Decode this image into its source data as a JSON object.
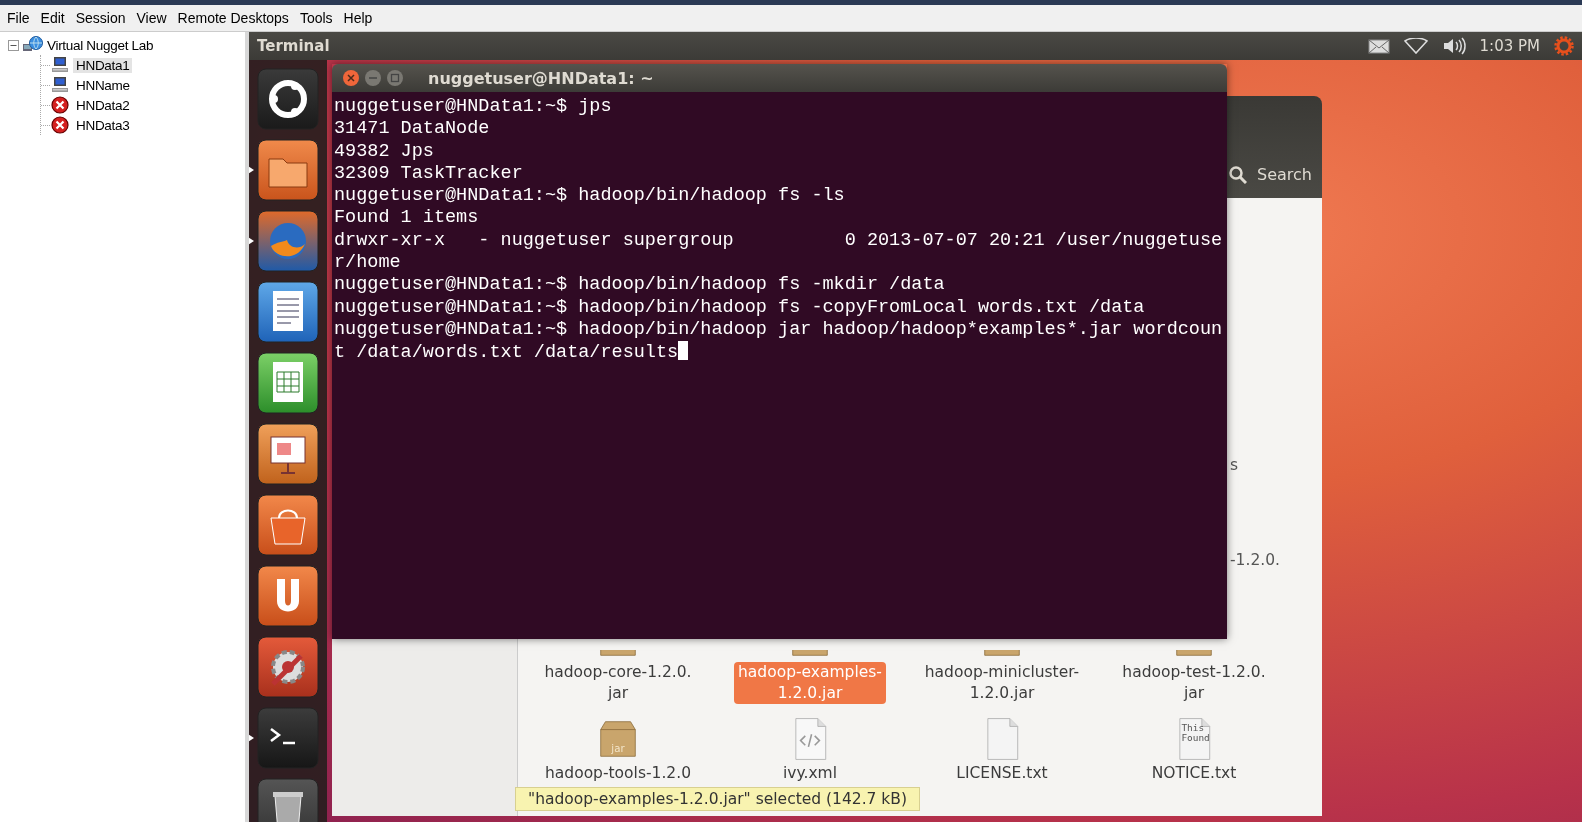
{
  "menu": [
    "File",
    "Edit",
    "Session",
    "View",
    "Remote Desktops",
    "Tools",
    "Help"
  ],
  "tree": {
    "label": "Virtual Nugget Lab",
    "expanded": true,
    "children": [
      {
        "label": "HNData1",
        "kind": "online",
        "selected": true
      },
      {
        "label": "HNName",
        "kind": "online",
        "selected": false
      },
      {
        "label": "HNData2",
        "kind": "offline",
        "selected": false
      },
      {
        "label": "HNData3",
        "kind": "offline",
        "selected": false
      }
    ]
  },
  "panel": {
    "title": "Terminal",
    "clock": "1:03 PM"
  },
  "launcher": [
    {
      "kind": "dash",
      "running": false
    },
    {
      "kind": "files",
      "running": true
    },
    {
      "kind": "browser",
      "running": true
    },
    {
      "kind": "writer",
      "running": false
    },
    {
      "kind": "calc",
      "running": false
    },
    {
      "kind": "impress",
      "running": false
    },
    {
      "kind": "store",
      "running": false
    },
    {
      "kind": "ubuntu-one",
      "running": false
    },
    {
      "kind": "settings",
      "running": false
    },
    {
      "kind": "terminal",
      "running": true
    },
    {
      "kind": "trash",
      "running": false
    }
  ],
  "terminal": {
    "title": "nuggetuser@HNData1: ~",
    "lines": [
      "nuggetuser@HNData1:~$ jps",
      "31471 DataNode",
      "49382 Jps",
      "32309 TaskTracker",
      "nuggetuser@HNData1:~$ hadoop/bin/hadoop fs -ls",
      "Found 1 items",
      "drwxr-xr-x   - nuggetuser supergroup          0 2013-07-07 20:21 /user/nuggetuse",
      "r/home",
      "nuggetuser@HNData1:~$ hadoop/bin/hadoop fs -mkdir /data",
      "nuggetuser@HNData1:~$ hadoop/bin/hadoop fs -copyFromLocal words.txt /data",
      "nuggetuser@HNData1:~$ hadoop/bin/hadoop jar hadoop/hadoop*examples*.jar wordcoun",
      "t /data/words.txt /data/results"
    ]
  },
  "files": {
    "search_label": "Search",
    "fragments": [
      "s",
      "-1.2.0."
    ],
    "items": [
      {
        "label": "hadoop-core-1.2.0.\njar",
        "kind": "jar",
        "selected": false
      },
      {
        "label": "hadoop-examples-\n1.2.0.jar",
        "kind": "jar",
        "selected": true
      },
      {
        "label": "hadoop-minicluster-\n1.2.0.jar",
        "kind": "jar",
        "selected": false
      },
      {
        "label": "hadoop-test-1.2.0.\njar",
        "kind": "jar",
        "selected": false
      },
      {
        "label": "hadoop-tools-1.2.0",
        "kind": "jar",
        "icon_text": "jar",
        "selected": false
      },
      {
        "label": "ivy.xml",
        "kind": "code",
        "selected": false
      },
      {
        "label": "LICENSE.txt",
        "kind": "text",
        "selected": false
      },
      {
        "label": "NOTICE.txt",
        "kind": "text",
        "icon_text": "This\nFound",
        "selected": false
      }
    ],
    "status": "\"hadoop-examples-1.2.0.jar\" selected (142.7 kB)"
  }
}
